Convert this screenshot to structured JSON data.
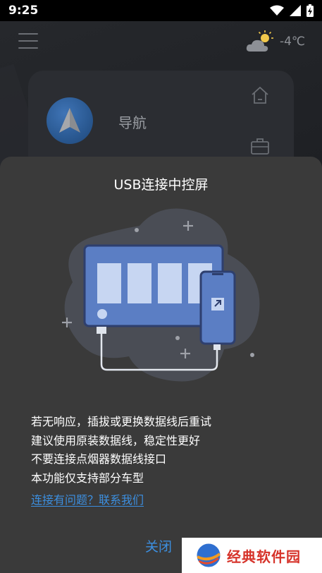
{
  "status_bar": {
    "time": "9:25"
  },
  "header": {
    "temperature": "-4℃"
  },
  "nav_card": {
    "label": "导航"
  },
  "dialog": {
    "title": "USB连接中控屏",
    "tips": [
      "若无响应，插拔或更换数据线后重试",
      "建议使用原装数据线，稳定性更好",
      "不要连接点烟器数据线接口",
      "本功能仅支持部分车型"
    ],
    "contact_link": "连接有问题？联系我们",
    "close_label": "关闭"
  },
  "watermark": {
    "text": "经典软件园"
  },
  "colors": {
    "accent": "#3c8fe0",
    "dialog_bg": "#3a3a3a",
    "screen_blue": "#5b7ec4"
  }
}
